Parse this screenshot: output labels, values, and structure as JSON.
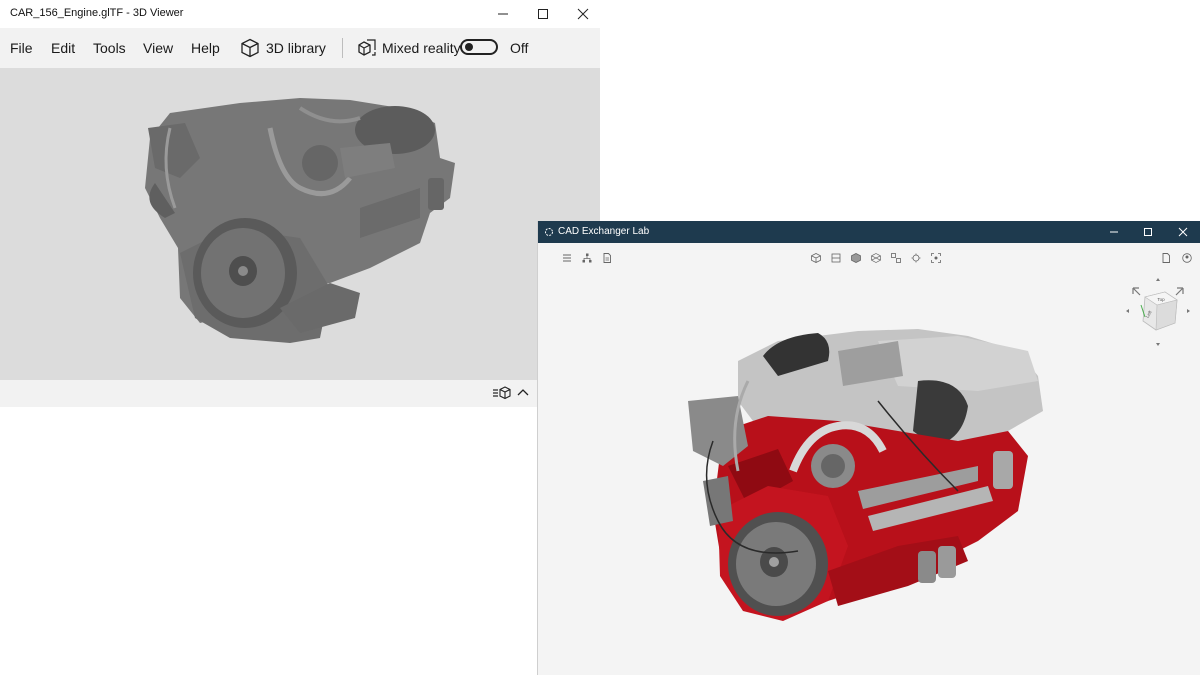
{
  "viewer": {
    "title": "CAR_156_Engine.glTF - 3D Viewer",
    "menu": {
      "file": "File",
      "edit": "Edit",
      "tools": "Tools",
      "view": "View",
      "help": "Help",
      "library": "3D library",
      "mixed_reality": "Mixed reality",
      "toggle_state": "Off"
    },
    "icons": [
      "cube-icon",
      "mixed-reality-icon",
      "expand-chevron-icon"
    ],
    "colors": {
      "viewport_bg": "#dcdcdc",
      "model": "#6f6f6f"
    }
  },
  "cad": {
    "title": "CAD Exchanger Lab",
    "viewcube": {
      "top_label": "Top",
      "front_label": "Left"
    },
    "colors": {
      "titlebar": "#1e3a4e",
      "engine_block": "#b8101a",
      "parts": "#bdbdbd"
    }
  }
}
